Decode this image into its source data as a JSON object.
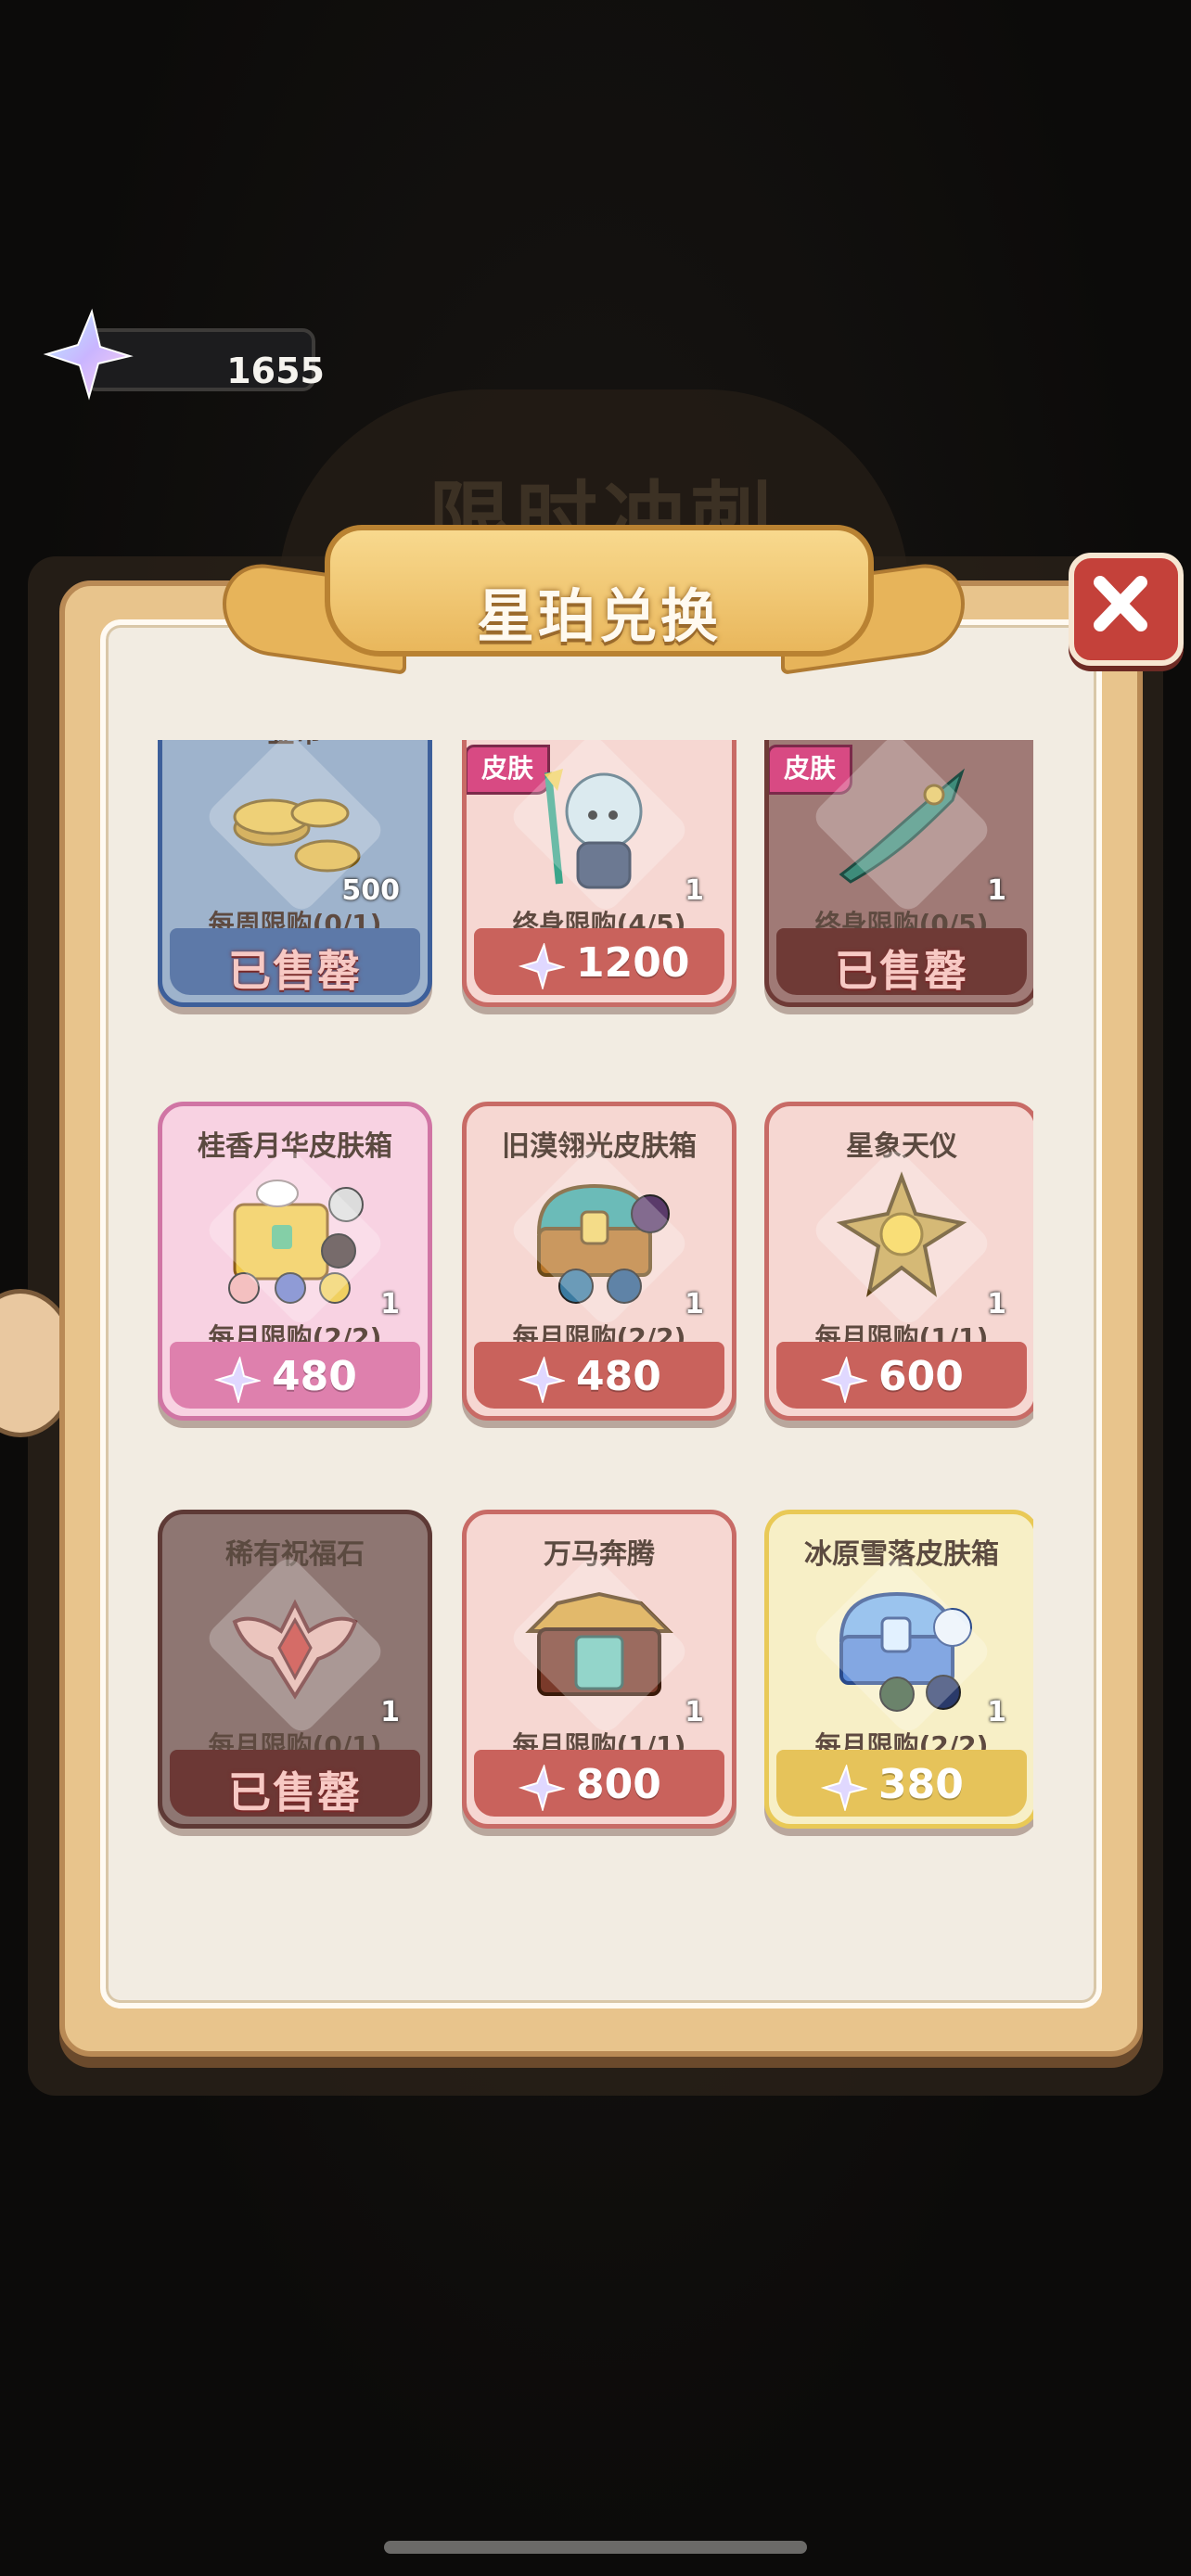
{
  "currency": {
    "amount": "1655",
    "icon": "star-crystal-icon"
  },
  "background_title": "限时冲刺",
  "panel": {
    "title": "星珀兑换",
    "close_icon": "close-icon"
  },
  "items": [
    {
      "name": "金币",
      "tag": "",
      "qty": "500",
      "limit": "每周限购(0/1)",
      "price": "",
      "sold_out": "已售罄",
      "style": "blue",
      "icon": "gold-coins-icon"
    },
    {
      "name": "",
      "tag": "皮肤",
      "qty": "1",
      "limit": "终身限购(4/5)",
      "price": "1200",
      "sold_out": "",
      "style": "red",
      "icon": "hero-skin-icon"
    },
    {
      "name": "",
      "tag": "皮肤",
      "qty": "1",
      "limit": "终身限购(0/5)",
      "price": "",
      "sold_out": "已售罄",
      "style": "darkred",
      "icon": "weapon-skin-icon"
    },
    {
      "name": "桂香月华皮肤箱",
      "tag": "",
      "qty": "1",
      "limit": "每月限购(2/2)",
      "price": "480",
      "sold_out": "",
      "style": "pink",
      "icon": "rabbit-chest-icon"
    },
    {
      "name": "旧漠翎光皮肤箱",
      "tag": "",
      "qty": "1",
      "limit": "每月限购(2/2)",
      "price": "480",
      "sold_out": "",
      "style": "red",
      "icon": "treasure-chest-icon"
    },
    {
      "name": "星象天仪",
      "tag": "",
      "qty": "1",
      "limit": "每月限购(1/1)",
      "price": "600",
      "sold_out": "",
      "style": "red",
      "icon": "astrolabe-icon"
    },
    {
      "name": "稀有祝福石",
      "tag": "",
      "qty": "1",
      "limit": "每月限购(0/1)",
      "price": "",
      "sold_out": "已售罄",
      "style": "brown",
      "icon": "blessing-stone-icon"
    },
    {
      "name": "万马奔腾",
      "tag": "",
      "qty": "1",
      "limit": "每月限购(1/1)",
      "price": "800",
      "sold_out": "",
      "style": "red",
      "icon": "ornate-chest-icon"
    },
    {
      "name": "冰原雪落皮肤箱",
      "tag": "",
      "qty": "1",
      "limit": "每月限购(2/2)",
      "price": "380",
      "sold_out": "",
      "style": "yellow",
      "icon": "ice-chest-icon"
    }
  ]
}
